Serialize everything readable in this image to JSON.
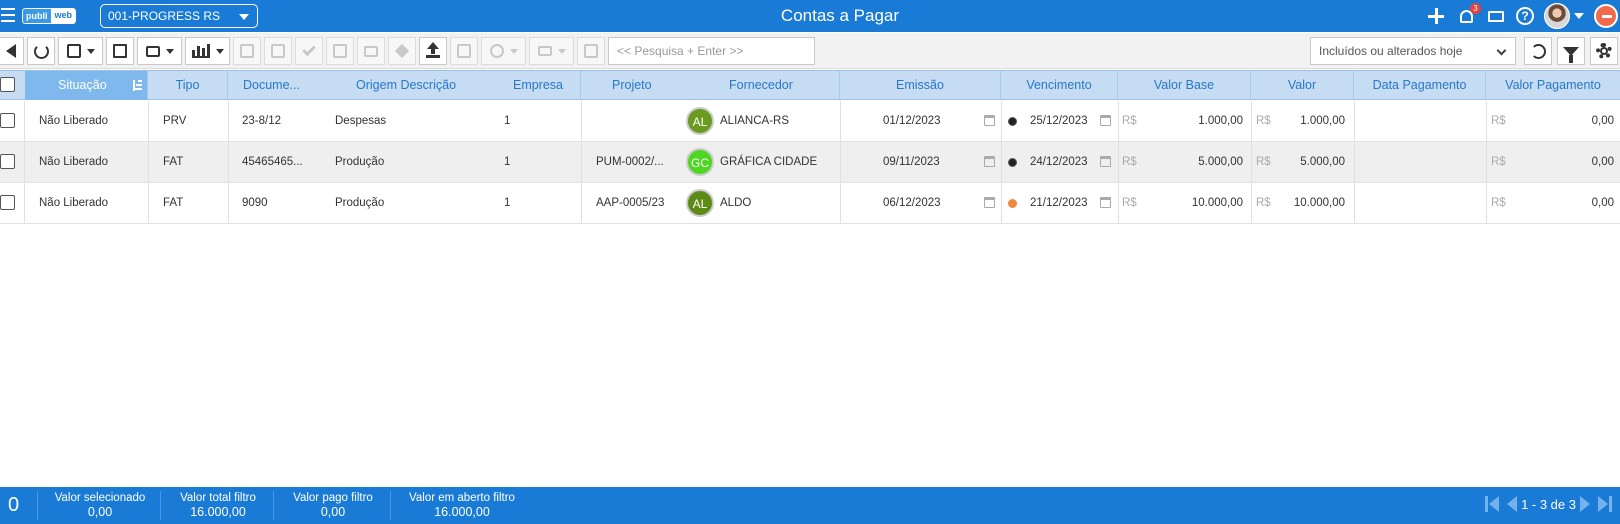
{
  "app": {
    "title": "Contas a Pagar",
    "logo_left": "publi",
    "logo_right": "web",
    "company": "001-PROGRESS RS",
    "notification_count": "3"
  },
  "toolbar": {
    "search_placeholder": "<< Pesquisa + Enter >>",
    "filter_value": "Incluídos ou alterados hoje"
  },
  "table": {
    "columns": [
      "Situação",
      "Tipo",
      "Docume...",
      "Origem Descrição",
      "Empresa",
      "Projeto",
      "Fornecedor",
      "Emissão",
      "Vencimento",
      "Valor Base",
      "Valor",
      "Data Pagamento",
      "Valor Pagamento"
    ],
    "currency": "R$",
    "rows": [
      {
        "situacao": "Não Liberado",
        "tipo": "PRV",
        "documento": "23-8/12",
        "origem": "Despesas",
        "empresa": "1",
        "projeto": "",
        "fornecedor_initials": "AL",
        "fornecedor_color": "#6a9a1f",
        "fornecedor": "ALIANCA-RS",
        "emissao": "01/12/2023",
        "vencimento": "25/12/2023",
        "status_color": "#222222",
        "valor_base": "1.000,00",
        "valor": "1.000,00",
        "data_pagamento": "",
        "valor_pagamento": "0,00"
      },
      {
        "situacao": "Não Liberado",
        "tipo": "FAT",
        "documento": "45465465...",
        "origem": "Produção",
        "empresa": "1",
        "projeto": "PUM-0002/...",
        "fornecedor_initials": "GC",
        "fornecedor_color": "#4fd621",
        "fornecedor": "GRÁFICA CIDADE",
        "emissao": "09/11/2023",
        "vencimento": "24/12/2023",
        "status_color": "#222222",
        "valor_base": "5.000,00",
        "valor": "5.000,00",
        "data_pagamento": "",
        "valor_pagamento": "0,00"
      },
      {
        "situacao": "Não Liberado",
        "tipo": "FAT",
        "documento": "9090",
        "origem": "Produção",
        "empresa": "1",
        "projeto": "AAP-0005/23",
        "fornecedor_initials": "AL",
        "fornecedor_color": "#5e8a17",
        "fornecedor": "ALDO",
        "emissao": "06/12/2023",
        "vencimento": "21/12/2023",
        "status_color": "#f0883e",
        "valor_base": "10.000,00",
        "valor": "10.000,00",
        "data_pagamento": "",
        "valor_pagamento": "0,00"
      }
    ]
  },
  "footer": {
    "selected_count": "0",
    "valor_selecionado_label": "Valor selecionado",
    "valor_selecionado": "0,00",
    "valor_total_label": "Valor total filtro",
    "valor_total": "16.000,00",
    "valor_pago_label": "Valor pago filtro",
    "valor_pago": "0,00",
    "valor_aberto_label": "Valor em aberto filtro",
    "valor_aberto": "16.000,00",
    "pagination": "1 - 3 de 3"
  },
  "icons": [
    "menu-icon",
    "bell-icon",
    "monitor-icon",
    "help-icon",
    "logout-icon",
    "back-icon",
    "refresh-icon",
    "add-icon",
    "excel-icon",
    "print-icon",
    "chart-icon",
    "filter-icon",
    "gear-icon",
    "calendar-icon",
    "sort-icon"
  ]
}
